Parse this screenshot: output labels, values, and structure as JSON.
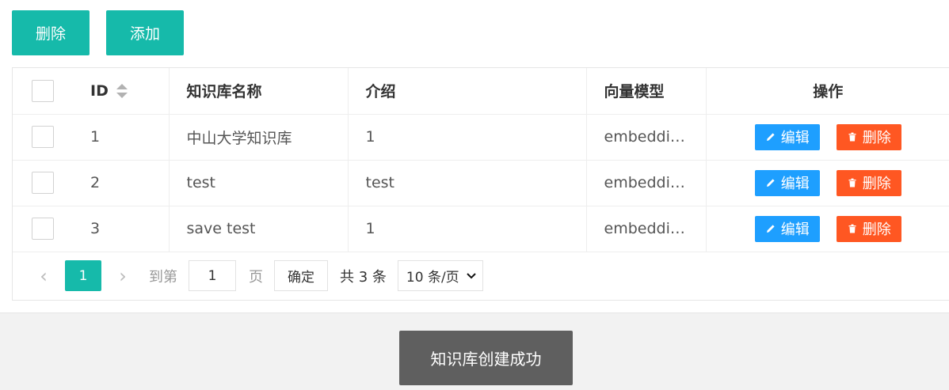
{
  "toolbar": {
    "delete_label": "删除",
    "add_label": "添加"
  },
  "table": {
    "headers": {
      "id": "ID",
      "name": "知识库名称",
      "intro": "介绍",
      "model": "向量模型",
      "ops": "操作"
    },
    "rows": [
      {
        "id": "1",
        "name": "中山大学知识库",
        "intro": "1",
        "model": "embeddi…"
      },
      {
        "id": "2",
        "name": "test",
        "intro": "test",
        "model": "embeddi…"
      },
      {
        "id": "3",
        "name": "save test",
        "intro": "1",
        "model": "embeddi…"
      }
    ],
    "edit_label": "编辑",
    "delete_label": "删除"
  },
  "pager": {
    "prev": "‹",
    "current": "1",
    "next": "›",
    "goto_label": "到第",
    "goto_value": "1",
    "page_unit": "页",
    "confirm": "确定",
    "total": "共 3 条",
    "page_size": "10 条/页"
  },
  "toast": {
    "message": "知识库创建成功"
  },
  "colors": {
    "primary": "#16baaa",
    "edit": "#1e9fff",
    "danger": "#ff5722",
    "toast_bg": "#5f5f5f"
  },
  "icons": {
    "edit": "pencil-icon",
    "delete": "trash-icon",
    "sort": "sort-icon",
    "select": "chevron-down-icon"
  }
}
